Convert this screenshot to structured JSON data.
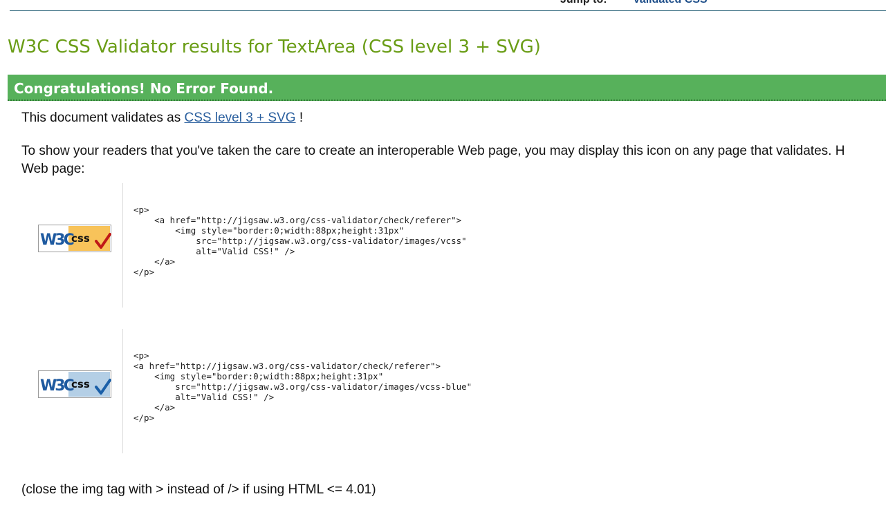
{
  "nav": {
    "jump_to_label": "Jump to:",
    "jump_link": "Validated CSS"
  },
  "page": {
    "title": "W3C CSS Validator results for TextArea (CSS level 3 + SVG)"
  },
  "banner": {
    "text": "Congratulations! No Error Found.",
    "color": "#57b15b"
  },
  "validation": {
    "prefix": "This document validates as ",
    "profile_link": "CSS level 3 + SVG",
    "suffix": " !"
  },
  "info": {
    "line1": "To show your readers that you've taken the care to create an interoperable Web page, you may display this icon on any page that validates. H",
    "line2": "Web page:"
  },
  "badges": [
    {
      "icon": "w3c-css-valid-badge-gold",
      "w3c_text": "W3C",
      "css_text": "css",
      "code": "<p>\n    <a href=\"http://jigsaw.w3.org/css-validator/check/referer\">\n        <img style=\"border:0;width:88px;height:31px\"\n            src=\"http://jigsaw.w3.org/css-validator/images/vcss\"\n            alt=\"Valid CSS!\" />\n    </a>\n</p>"
    },
    {
      "icon": "w3c-css-valid-badge-blue",
      "w3c_text": "W3C",
      "css_text": "css",
      "code": "<p>\n<a href=\"http://jigsaw.w3.org/css-validator/check/referer\">\n    <img style=\"border:0;width:88px;height:31px\"\n        src=\"http://jigsaw.w3.org/css-validator/images/vcss-blue\"\n        alt=\"Valid CSS!\" />\n    </a>\n</p>"
    }
  ],
  "note": {
    "text": "(close the img tag with > instead of /> if using HTML <= 4.01)"
  }
}
